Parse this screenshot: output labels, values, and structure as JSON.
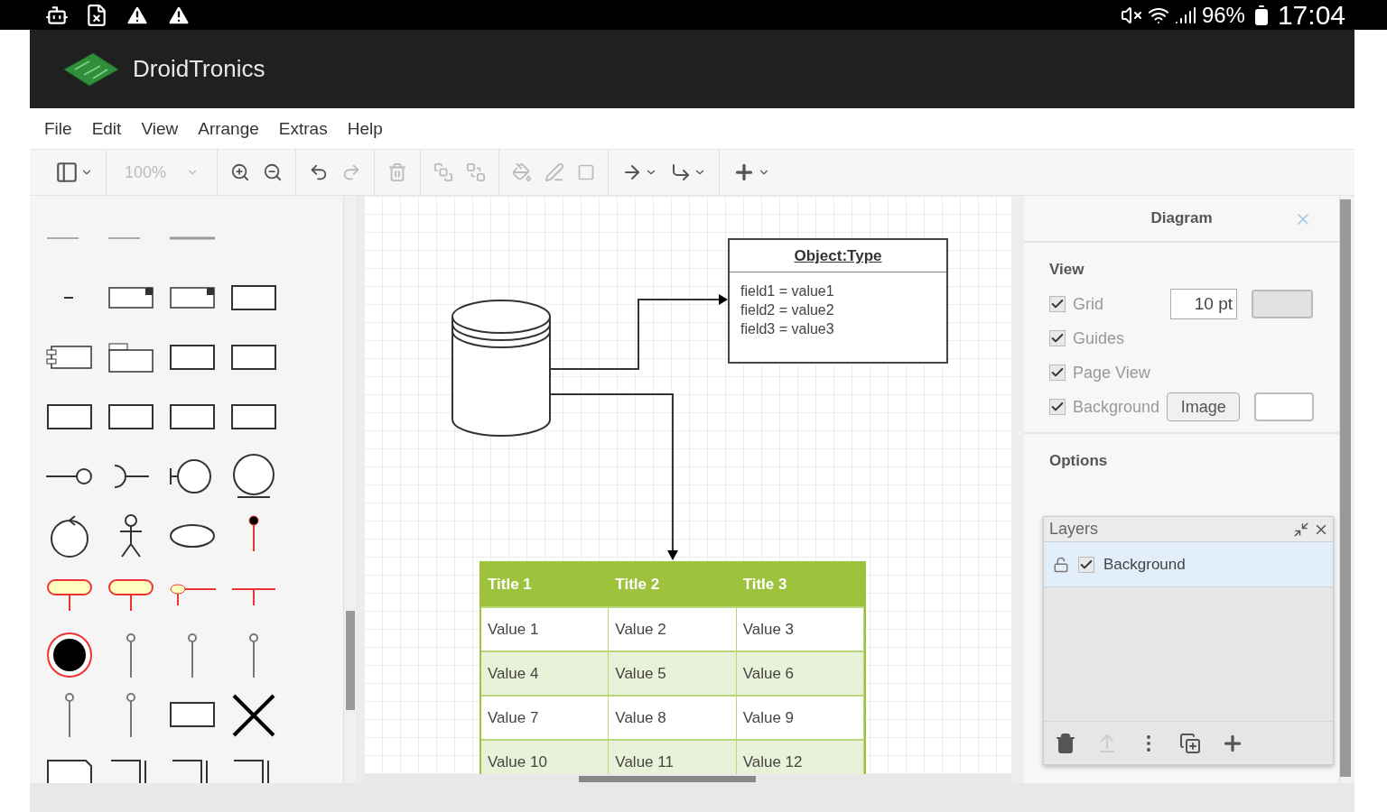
{
  "status_bar": {
    "battery": "96%",
    "time": "17:04"
  },
  "app": {
    "title": "DroidTronics"
  },
  "menu": [
    "File",
    "Edit",
    "View",
    "Arrange",
    "Extras",
    "Help"
  ],
  "toolbar": {
    "zoom": "100%"
  },
  "diagram": {
    "object": {
      "title": "Object:Type",
      "fields": [
        "field1 = value1",
        "field2 = value2",
        "field3 = value3"
      ]
    },
    "table": {
      "columns": [
        "Title 1",
        "Title 2",
        "Title 3"
      ],
      "rows": [
        [
          "Value 1",
          "Value 2",
          "Value 3"
        ],
        [
          "Value 4",
          "Value 5",
          "Value 6"
        ],
        [
          "Value 7",
          "Value 8",
          "Value 9"
        ],
        [
          "Value 10",
          "Value 11",
          "Value 12"
        ]
      ]
    }
  },
  "format_panel": {
    "title": "Diagram",
    "view_heading": "View",
    "view_options": [
      {
        "kind": "spinner",
        "label": "Grid",
        "checked": true,
        "value": "10 pt"
      },
      {
        "kind": "plain",
        "label": "Guides",
        "checked": true
      },
      {
        "kind": "plain",
        "label": "Page View",
        "checked": true
      },
      {
        "kind": "image",
        "label": "Background",
        "checked": true,
        "button": "Image"
      }
    ],
    "options_heading": "Options"
  },
  "layers": {
    "title": "Layers",
    "items": [
      {
        "name": "Background",
        "visible": true,
        "selected": true
      }
    ]
  }
}
